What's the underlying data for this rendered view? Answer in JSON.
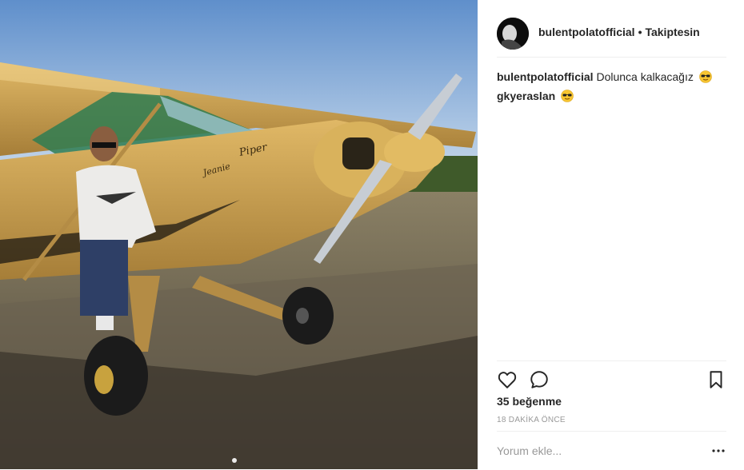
{
  "post": {
    "username": "bulentpolatofficial",
    "separator": "•",
    "follow_status": "Takiptesin",
    "comments": [
      {
        "user": "bulentpolatofficial",
        "text": "Dolunca kalkacağız",
        "emoji": "sunglasses-emoji"
      },
      {
        "user": "gkyeraslan",
        "text": "",
        "emoji": "sunglasses-emoji"
      }
    ],
    "likes": "35 beğenme",
    "timestamp": "18 DAKİKA ÖNCE",
    "comment_placeholder": "Yorum ekle...",
    "more_label": "•••"
  },
  "photo": {
    "plane_text": "Piper",
    "plane_name": "Jeanie"
  },
  "icons": {
    "like": "heart-icon",
    "comment": "speech-bubble-icon",
    "save": "bookmark-icon",
    "more": "ellipsis-icon"
  },
  "colors": {
    "plane_yellow": "#c9a24a",
    "sky": "#7ea7d6",
    "text": "#262626",
    "muted": "#999999",
    "divider": "#efefef"
  }
}
